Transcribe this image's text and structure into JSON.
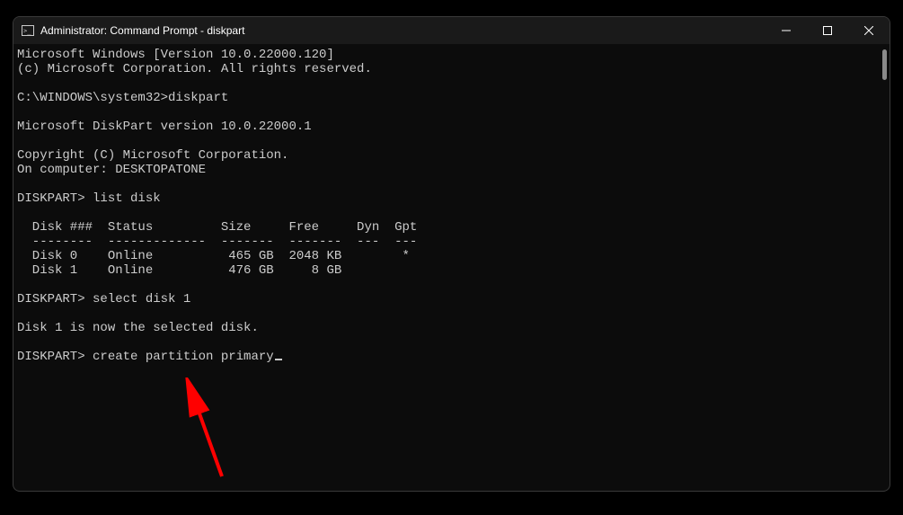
{
  "titlebar": {
    "title": "Administrator: Command Prompt - diskpart"
  },
  "terminal": {
    "line_version": "Microsoft Windows [Version 10.0.22000.120]",
    "line_copyright": "(c) Microsoft Corporation. All rights reserved.",
    "blank": "",
    "prompt1_path": "C:\\WINDOWS\\system32>",
    "prompt1_cmd": "diskpart",
    "diskpart_version": "Microsoft DiskPart version 10.0.22000.1",
    "diskpart_copyright": "Copyright (C) Microsoft Corporation.",
    "computer_line": "On computer: DESKTOPATONE",
    "dp_prompt": "DISKPART> ",
    "cmd_list": "list disk",
    "table_header": "  Disk ###  Status         Size     Free     Dyn  Gpt",
    "table_div": "  --------  -------------  -------  -------  ---  ---",
    "table_row0": "  Disk 0    Online          465 GB  2048 KB        *",
    "table_row1": "  Disk 1    Online          476 GB     8 GB",
    "cmd_select": "select disk 1",
    "selected_msg": "Disk 1 is now the selected disk.",
    "cmd_create": "create partition primary"
  }
}
